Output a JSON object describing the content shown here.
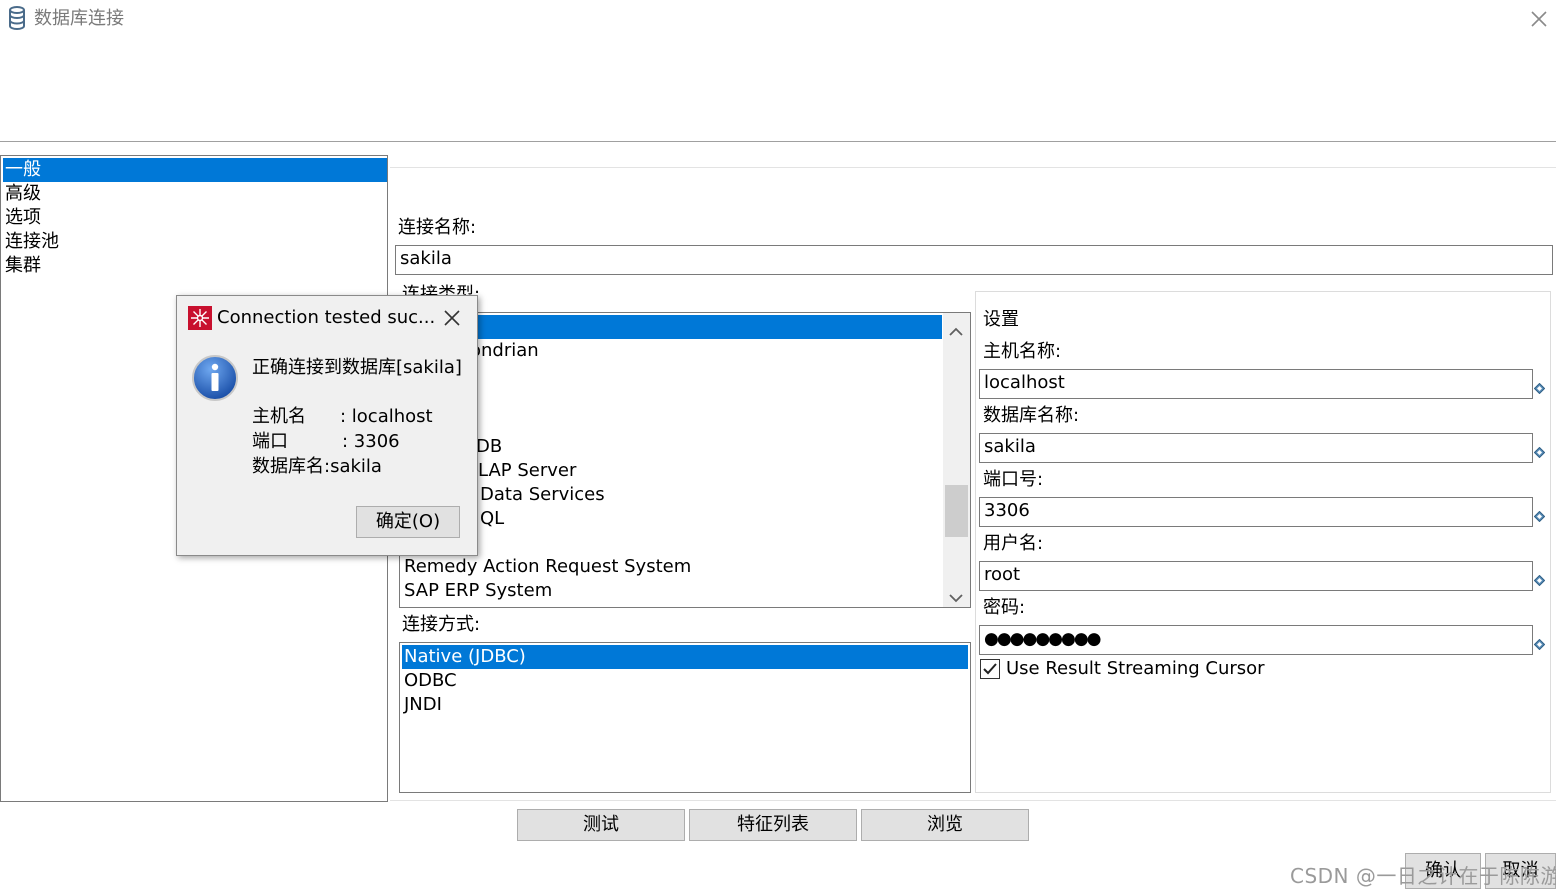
{
  "window": {
    "title": "数据库连接",
    "icon": "database-icon",
    "close_icon": "close-icon"
  },
  "nav": {
    "items": [
      {
        "label": "一般",
        "selected": true
      },
      {
        "label": "高级",
        "selected": false
      },
      {
        "label": "选项",
        "selected": false
      },
      {
        "label": "连接池",
        "selected": false
      },
      {
        "label": "集群",
        "selected": false
      }
    ]
  },
  "form": {
    "connection_name_label": "连接名称:",
    "connection_name_value": "sakila",
    "connection_type_label": "连接类型:",
    "connection_types_visible": [
      "ondrian",
      "DB",
      "LAP Server",
      "Data Services",
      "QL",
      "Remedy Action Request System",
      "SAP ERP System"
    ],
    "access_label": "连接方式:",
    "access_methods": [
      {
        "label": "Native (JDBC)",
        "selected": true
      },
      {
        "label": "ODBC",
        "selected": false
      },
      {
        "label": "JNDI",
        "selected": false
      }
    ]
  },
  "settings": {
    "title": "设置",
    "host_label": "主机名称:",
    "host_value": "localhost",
    "db_label": "数据库名称:",
    "db_value": "sakila",
    "port_label": "端口号:",
    "port_value": "3306",
    "user_label": "用户名:",
    "user_value": "root",
    "password_label": "密码:",
    "password_value": "●●●●●●●●●",
    "streaming_label": "Use Result Streaming Cursor",
    "streaming_checked": true
  },
  "buttons": {
    "test": "测试",
    "features": "特征列表",
    "browse": "浏览",
    "ok": "确认",
    "cancel": "取消"
  },
  "dialog": {
    "title": "Connection tested suc...",
    "message": "正确连接到数据库[sakila]",
    "host_label": "主机名",
    "host_value": ": localhost",
    "port_label": "端口",
    "port_value": ": 3306",
    "db_line": "数据库名:sakila",
    "ok_button": "确定(O)"
  },
  "watermark": "CSDN @一日之计在于陈陈游",
  "colors": {
    "selection": "#0078d7",
    "app_icon_red": "#c8102e"
  }
}
